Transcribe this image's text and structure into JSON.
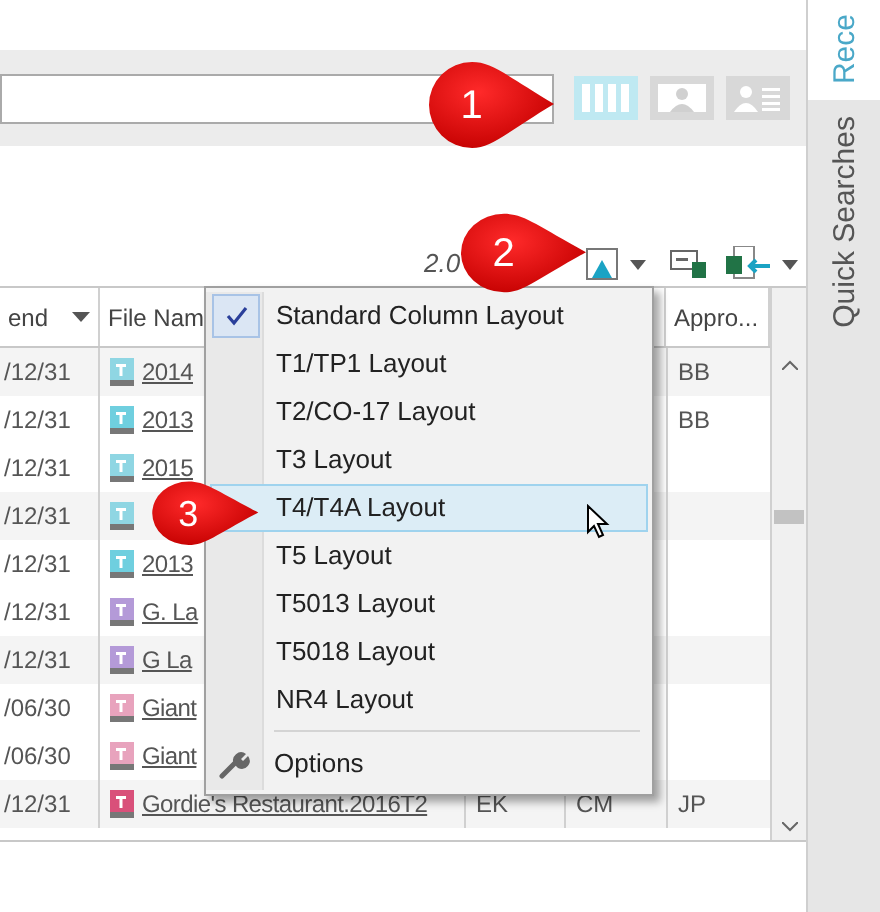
{
  "view_buttons": [
    {
      "kind": "columns",
      "selected": true
    },
    {
      "kind": "card",
      "selected": false
    },
    {
      "kind": "list",
      "selected": false
    }
  ],
  "version_label": "2.0",
  "side_tabs": [
    {
      "label": "Rece",
      "selected": true
    },
    {
      "label": "Quick Searches",
      "selected": false
    }
  ],
  "table": {
    "columns": [
      {
        "label": "end",
        "filter": true
      },
      {
        "label": "File Nam"
      },
      {
        "label": "Appro..."
      }
    ],
    "rows": [
      {
        "date": "/12/31",
        "file": "2014",
        "color": "#8fd6e3",
        "cells": [
          "",
          "",
          "BB"
        ]
      },
      {
        "date": "/12/31",
        "file": "2013",
        "color": "#6fcfdf",
        "cells": [
          "",
          "",
          "BB"
        ]
      },
      {
        "date": "/12/31",
        "file": "2015",
        "color": "#8fd6e3",
        "cells": [
          "",
          "",
          ""
        ]
      },
      {
        "date": "/12/31",
        "file": "",
        "color": "#8fd6e3",
        "cells": [
          "",
          "",
          ""
        ]
      },
      {
        "date": "/12/31",
        "file": "2013",
        "color": "#6fcfdf",
        "cells": [
          "",
          "",
          ""
        ]
      },
      {
        "date": "/12/31",
        "file": "G. La",
        "color": "#b49ad8",
        "cells": [
          "",
          "",
          ""
        ]
      },
      {
        "date": "/12/31",
        "file": "G La",
        "color": "#b49ad8",
        "cells": [
          "",
          "",
          ""
        ]
      },
      {
        "date": "/06/30",
        "file": "Giant",
        "color": "#e8a3bd",
        "cells": [
          "",
          "",
          ""
        ]
      },
      {
        "date": "/06/30",
        "file": "Giant",
        "color": "#e8a3bd",
        "cells": [
          "",
          "",
          ""
        ]
      },
      {
        "date": "/12/31",
        "file": "Gordie's Restaurant.2016T2",
        "color": "#d9507a",
        "cells": [
          "EK",
          "CM",
          "JP"
        ]
      }
    ]
  },
  "menu": {
    "items": [
      {
        "label": "Standard Column Layout",
        "checked": true,
        "selected": false
      },
      {
        "label": "T1/TP1 Layout",
        "checked": false,
        "selected": false
      },
      {
        "label": "T2/CO-17 Layout",
        "checked": false,
        "selected": false
      },
      {
        "label": "T3 Layout",
        "checked": false,
        "selected": false
      },
      {
        "label": "T4/T4A Layout",
        "checked": false,
        "selected": true
      },
      {
        "label": "T5 Layout",
        "checked": false,
        "selected": false
      },
      {
        "label": "T5013 Layout",
        "checked": false,
        "selected": false
      },
      {
        "label": "T5018 Layout",
        "checked": false,
        "selected": false
      },
      {
        "label": "NR4 Layout",
        "checked": false,
        "selected": false
      }
    ],
    "footer_item": {
      "label": "Options"
    }
  },
  "callouts": [
    {
      "number": "1"
    },
    {
      "number": "2"
    },
    {
      "number": "3"
    }
  ]
}
